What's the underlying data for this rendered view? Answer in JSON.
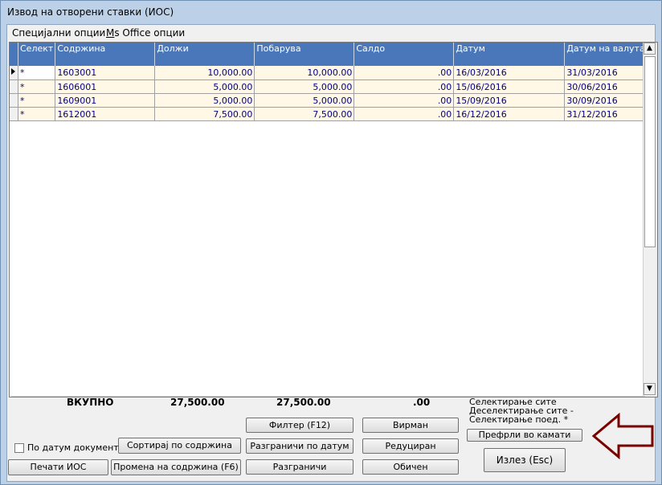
{
  "window": {
    "title": "Извод на отворени ставки (ИОС)"
  },
  "menu": {
    "item1": "Специјални опции",
    "item2_u": "M",
    "item2_rest": "s Office опции"
  },
  "grid": {
    "columns": [
      "Селект",
      "Содржина",
      "Должи",
      "Побарува",
      "Салдо",
      "Датум",
      "Датум на валута"
    ],
    "rows": [
      {
        "select": "*",
        "content": "1603001",
        "debit": "10,000.00",
        "credit": "10,000.00",
        "balance": ".00",
        "date": "16/03/2016",
        "due": "31/03/2016"
      },
      {
        "select": "*",
        "content": "1606001",
        "debit": "5,000.00",
        "credit": "5,000.00",
        "balance": ".00",
        "date": "15/06/2016",
        "due": "30/06/2016"
      },
      {
        "select": "*",
        "content": "1609001",
        "debit": "5,000.00",
        "credit": "5,000.00",
        "balance": ".00",
        "date": "15/09/2016",
        "due": "30/09/2016"
      },
      {
        "select": "*",
        "content": "1612001",
        "debit": "7,500.00",
        "credit": "7,500.00",
        "balance": ".00",
        "date": "16/12/2016",
        "due": "31/12/2016"
      }
    ]
  },
  "totals": {
    "label": "ВКУПНО",
    "debit": "27,500.00",
    "credit": "27,500.00",
    "balance": ".00"
  },
  "selection": {
    "select_all": "Селектирање сите",
    "deselect_all": "Деселектирање сите -",
    "select_single": "Селектирање поед. *"
  },
  "buttons": {
    "filter": "Филтер (F12)",
    "transfer": "Вирман",
    "split_by_date": "Разграничи по датум",
    "reduced": "Редуциран",
    "split": "Разграничи",
    "normal": "Обичен",
    "to_interest": "Префрли во камати",
    "exit": "Излез (Esc)",
    "sort": "Сортирај по содржина",
    "print": "Печати ИОС",
    "change_content": "Промена на содржина (F6)"
  },
  "checkbox": {
    "label": "По датум документ",
    "checked": false
  },
  "colors": {
    "header": "#4a77b9",
    "row_bg": "#fff8e7",
    "row_text": "#000080",
    "arrow": "#7a0000"
  }
}
